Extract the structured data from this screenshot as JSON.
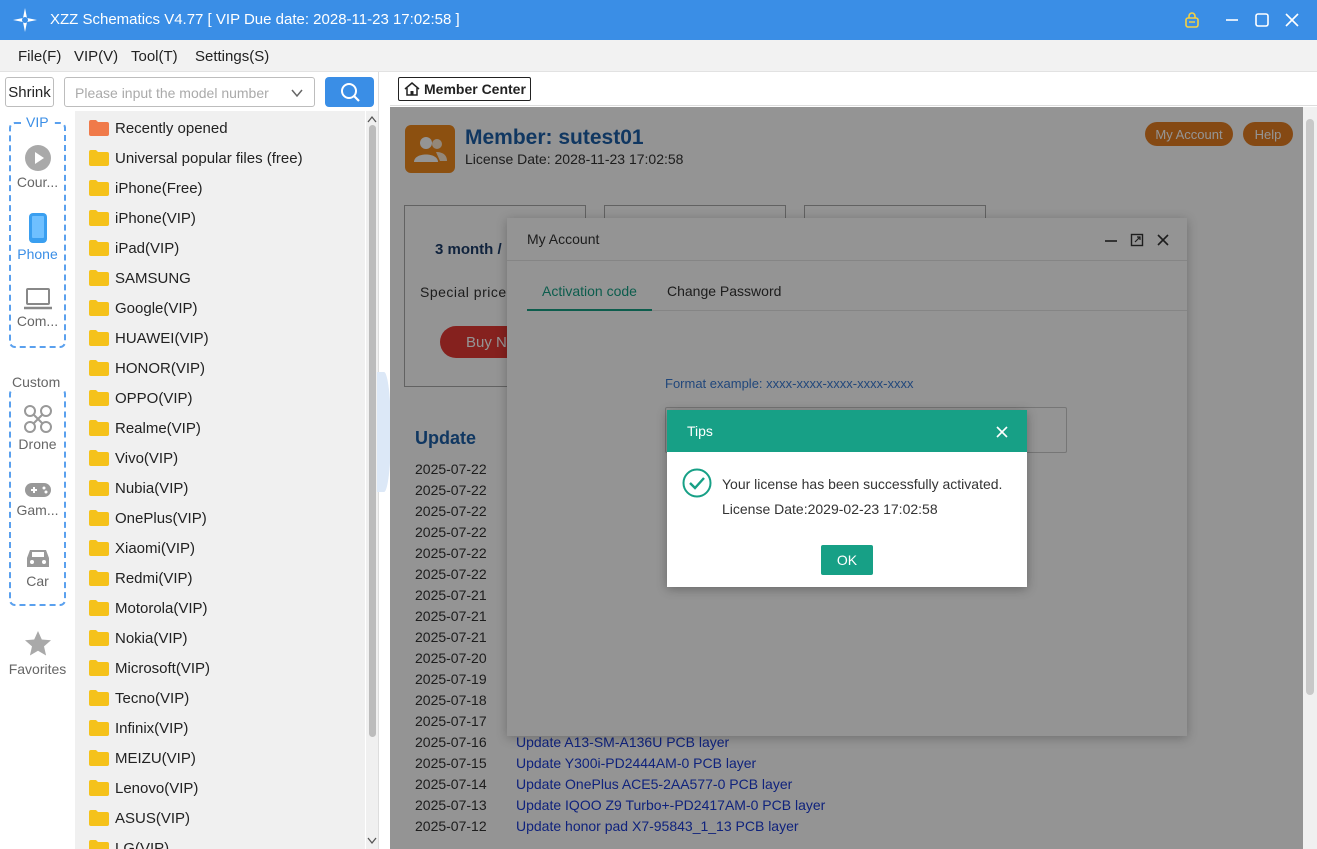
{
  "window": {
    "title": "XZZ Schematics V4.77 [ VIP Due date: 2028-11-23 17:02:58 ]"
  },
  "menu": [
    "File(F)",
    "VIP(V)",
    "Tool(T)",
    "Settings(S)"
  ],
  "search": {
    "shrink_label": "Shrink",
    "placeholder": "Please input the model number",
    "button_icon": "search-icon"
  },
  "leftnav": {
    "vip_group_label": "VIP",
    "custom_group_label": "Custom",
    "items": [
      {
        "label": "Cour...",
        "icon": "play-icon",
        "active": false
      },
      {
        "label": "Phone",
        "icon": "phone-icon",
        "active": true
      },
      {
        "label": "Com...",
        "icon": "laptop-icon",
        "active": false
      },
      {
        "label": "Drone",
        "icon": "drone-icon",
        "active": false
      },
      {
        "label": "Gam...",
        "icon": "gamepad-icon",
        "active": false
      },
      {
        "label": "Car",
        "icon": "car-icon",
        "active": false
      },
      {
        "label": "Favorites",
        "icon": "star-icon",
        "active": false
      }
    ]
  },
  "tree": {
    "items": [
      "Recently opened",
      "Universal popular files (free)",
      "iPhone(Free)",
      "iPhone(VIP)",
      "iPad(VIP)",
      "SAMSUNG",
      "Google(VIP)",
      "HUAWEI(VIP)",
      "HONOR(VIP)",
      "OPPO(VIP)",
      "Realme(VIP)",
      "Vivo(VIP)",
      "Nubia(VIP)",
      "OnePlus(VIP)",
      "Xiaomi(VIP)",
      "Redmi(VIP)",
      "Motorola(VIP)",
      "Nokia(VIP)",
      "Microsoft(VIP)",
      "Tecno(VIP)",
      "Infinix(VIP)",
      "MEIZU(VIP)",
      "Lenovo(VIP)",
      "ASUS(VIP)",
      "LG(VIP)"
    ]
  },
  "tab": {
    "label": "Member Center"
  },
  "member": {
    "name": "Member: sutest01",
    "license_date": "License Date: 2028-11-23 17:02:58",
    "my_account": "My Account",
    "help": "Help",
    "plan_title": "3 month /",
    "special_price": "Special price",
    "buy_label": "Buy N"
  },
  "updates": {
    "title": "Update",
    "rows": [
      {
        "date": "2025-07-22",
        "text": ""
      },
      {
        "date": "2025-07-22",
        "text": ""
      },
      {
        "date": "2025-07-22",
        "text": ""
      },
      {
        "date": "2025-07-22",
        "text": ""
      },
      {
        "date": "2025-07-22",
        "text": ""
      },
      {
        "date": "2025-07-22",
        "text": ""
      },
      {
        "date": "2025-07-21",
        "text": ""
      },
      {
        "date": "2025-07-21",
        "text": ""
      },
      {
        "date": "2025-07-21",
        "text": ""
      },
      {
        "date": "2025-07-20",
        "text": ""
      },
      {
        "date": "2025-07-19",
        "text": ""
      },
      {
        "date": "2025-07-18",
        "text": ""
      },
      {
        "date": "2025-07-17",
        "text": ""
      },
      {
        "date": "2025-07-16",
        "text": "Update A13-SM-A136U PCB layer"
      },
      {
        "date": "2025-07-15",
        "text": "Update Y300i-PD2444AM-0 PCB layer"
      },
      {
        "date": "2025-07-14",
        "text": "Update OnePlus ACE5-2AA577-0 PCB layer"
      },
      {
        "date": "2025-07-13",
        "text": "Update IQOO Z9 Turbo+-PD2417AM-0 PCB layer"
      },
      {
        "date": "2025-07-12",
        "text": "Update honor pad X7-95843_1_13 PCB layer"
      }
    ]
  },
  "account_dialog": {
    "title": "My Account",
    "tabs": [
      "Activation code",
      "Change Password"
    ],
    "format_example": "Format example: xxxx-xxxx-xxxx-xxxx-xxxx"
  },
  "tips": {
    "title": "Tips",
    "message": "Your license has been successfully activated.",
    "license_date": "License Date:2029-02-23 17:02:58",
    "ok": "OK"
  },
  "colors": {
    "titlebar": "#3a8ee6",
    "accent_teal": "#17a086",
    "orange": "#e67e22",
    "link": "#1a3bd6"
  }
}
